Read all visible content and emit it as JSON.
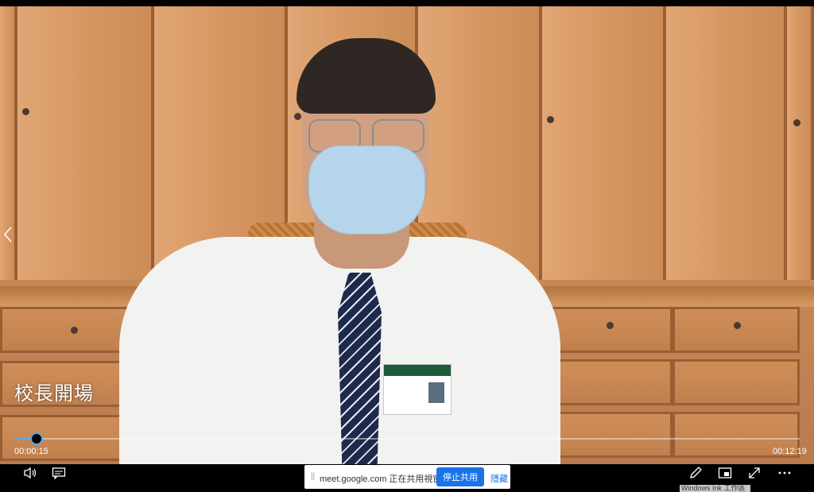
{
  "video": {
    "caption": "校長開場",
    "elapsed": "00:00:15",
    "duration": "00:12:19",
    "progress_fraction": 0.02
  },
  "share_bar": {
    "message": "meet.google.com 正在共用視窗。",
    "stop_label": "停止共用",
    "hide_label": "隱藏"
  },
  "taskbar_hint": "Windows Ink 工作區",
  "icons": {
    "previous": "chevron-left-icon",
    "volume": "volume-icon",
    "subtitles": "subtitles-icon",
    "pen": "pen-icon",
    "mini_view": "mini-view-icon",
    "fullscreen": "fullscreen-icon",
    "more": "more-icon"
  },
  "colors": {
    "accent": "#5aa9e6",
    "stop_button": "#1a73e8"
  }
}
